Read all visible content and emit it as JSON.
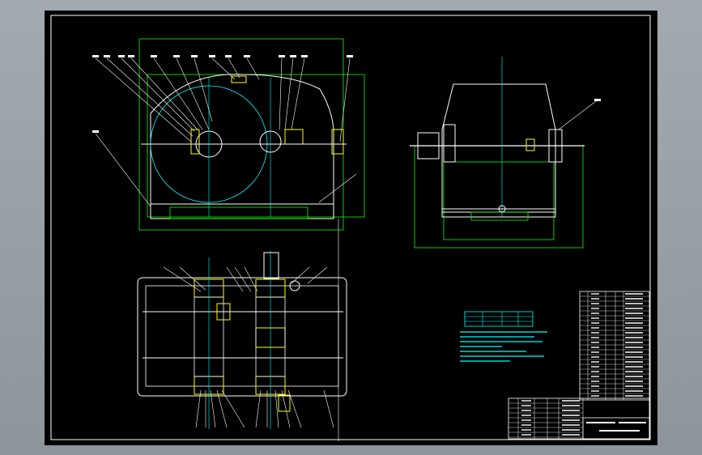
{
  "colors": {
    "background_frame": "#9aa0a8",
    "sheet": "#000000",
    "border": "#ffffff",
    "outline": "#ffffff",
    "dimension": "#00ff00",
    "hatch": "#ffff00",
    "centerline": "#00ffff",
    "annotation": "#00ffff",
    "highlight": "#ff00ff"
  },
  "views": {
    "front_view": "front-elevation",
    "side_view": "side-elevation",
    "top_view": "plan-section"
  }
}
